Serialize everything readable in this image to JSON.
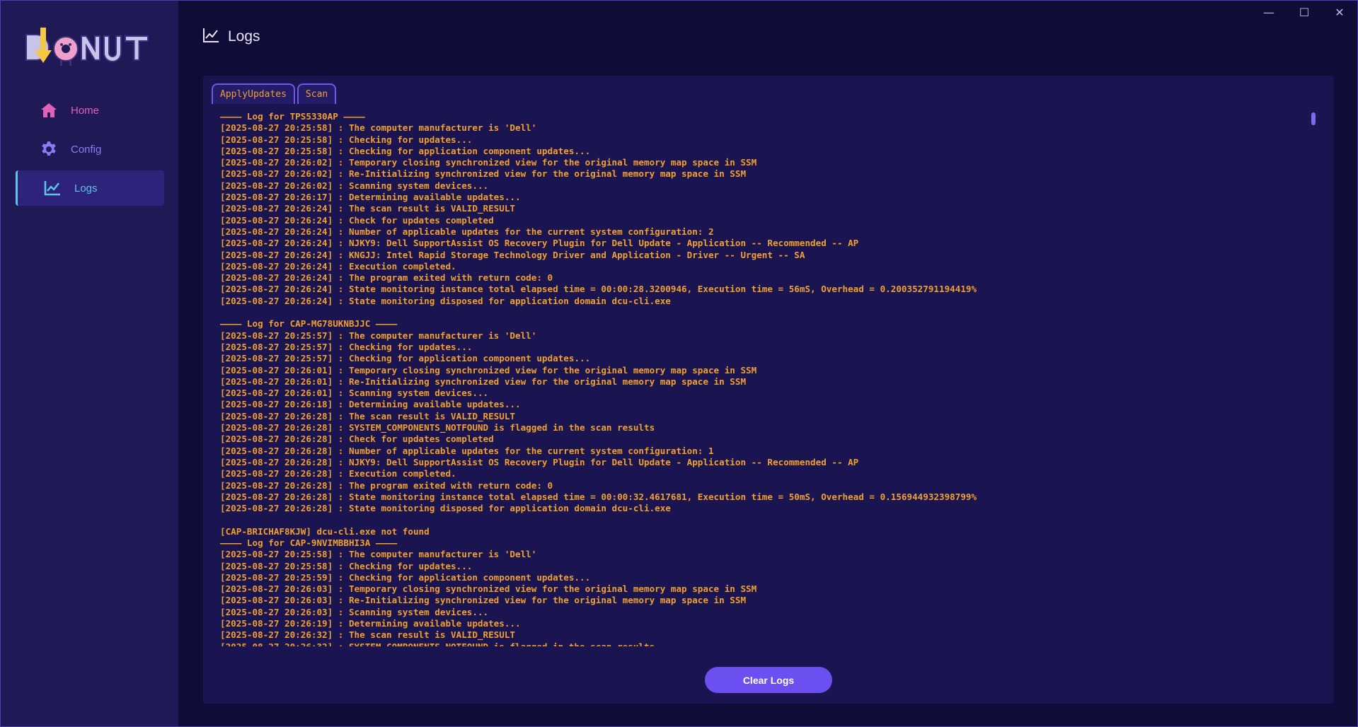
{
  "app": {
    "logo_text": "DONUT"
  },
  "sidebar": {
    "items": [
      {
        "label": "Home",
        "icon": "home-icon",
        "color": "#e45fb8"
      },
      {
        "label": "Config",
        "icon": "gear-icon",
        "color": "#8b7cf5"
      },
      {
        "label": "Logs",
        "icon": "chart-line-icon",
        "color": "#5cc5e8"
      }
    ]
  },
  "header": {
    "title": "Logs"
  },
  "window_controls": {
    "minimize": "—",
    "maximize": "☐",
    "close": "✕"
  },
  "tabs": [
    {
      "label": "ApplyUpdates"
    },
    {
      "label": "Scan"
    }
  ],
  "log_lines": [
    "———— Log for TPS5330AP ————",
    "[2025-08-27 20:25:58] : The computer manufacturer is 'Dell'",
    "[2025-08-27 20:25:58] : Checking for updates...",
    "[2025-08-27 20:25:58] : Checking for application component updates...",
    "[2025-08-27 20:26:02] : Temporary closing synchronized view for the original memory map space in SSM",
    "[2025-08-27 20:26:02] : Re-Initializing synchronized view for the original memory map space in SSM",
    "[2025-08-27 20:26:02] : Scanning system devices...",
    "[2025-08-27 20:26:17] : Determining available updates...",
    "[2025-08-27 20:26:24] : The scan result is VALID_RESULT",
    "[2025-08-27 20:26:24] : Check for updates completed",
    "[2025-08-27 20:26:24] : Number of applicable updates for the current system configuration: 2",
    "[2025-08-27 20:26:24] : NJKY9: Dell SupportAssist OS Recovery Plugin for Dell Update - Application -- Recommended -- AP",
    "[2025-08-27 20:26:24] : KNGJJ: Intel Rapid Storage Technology Driver and Application - Driver -- Urgent -- SA",
    "[2025-08-27 20:26:24] : Execution completed.",
    "[2025-08-27 20:26:24] : The program exited with return code: 0",
    "[2025-08-27 20:26:24] : State monitoring instance total elapsed time = 00:00:28.3200946, Execution time = 56mS, Overhead = 0.200352791194419%",
    "[2025-08-27 20:26:24] : State monitoring disposed for application domain dcu-cli.exe",
    "",
    "———— Log for CAP-MG78UKNBJJC ————",
    "[2025-08-27 20:25:57] : The computer manufacturer is 'Dell'",
    "[2025-08-27 20:25:57] : Checking for updates...",
    "[2025-08-27 20:25:57] : Checking for application component updates...",
    "[2025-08-27 20:26:01] : Temporary closing synchronized view for the original memory map space in SSM",
    "[2025-08-27 20:26:01] : Re-Initializing synchronized view for the original memory map space in SSM",
    "[2025-08-27 20:26:01] : Scanning system devices...",
    "[2025-08-27 20:26:18] : Determining available updates...",
    "[2025-08-27 20:26:28] : The scan result is VALID_RESULT",
    "[2025-08-27 20:26:28] : SYSTEM_COMPONENTS_NOTFOUND is flagged in the scan results",
    "[2025-08-27 20:26:28] : Check for updates completed",
    "[2025-08-27 20:26:28] : Number of applicable updates for the current system configuration: 1",
    "[2025-08-27 20:26:28] : NJKY9: Dell SupportAssist OS Recovery Plugin for Dell Update - Application -- Recommended -- AP",
    "[2025-08-27 20:26:28] : Execution completed.",
    "[2025-08-27 20:26:28] : The program exited with return code: 0",
    "[2025-08-27 20:26:28] : State monitoring instance total elapsed time = 00:00:32.4617681, Execution time = 50mS, Overhead = 0.156944932398799%",
    "[2025-08-27 20:26:28] : State monitoring disposed for application domain dcu-cli.exe",
    "",
    "[CAP-BRICHAF8KJW] dcu-cli.exe not found",
    "———— Log for CAP-9NVIMBBHI3A ————",
    "[2025-08-27 20:25:58] : The computer manufacturer is 'Dell'",
    "[2025-08-27 20:25:58] : Checking for updates...",
    "[2025-08-27 20:25:59] : Checking for application component updates...",
    "[2025-08-27 20:26:03] : Temporary closing synchronized view for the original memory map space in SSM",
    "[2025-08-27 20:26:03] : Re-Initializing synchronized view for the original memory map space in SSM",
    "[2025-08-27 20:26:03] : Scanning system devices...",
    "[2025-08-27 20:26:19] : Determining available updates...",
    "[2025-08-27 20:26:32] : The scan result is VALID_RESULT",
    "[2025-08-27 20:26:32] : SYSTEM_COMPONENTS_NOTFOUND is flagged in the scan results"
  ],
  "actions": {
    "clear_label": "Clear Logs"
  },
  "colors": {
    "log_text": "#f0a030",
    "accent": "#6c4ff0",
    "sidebar_bg": "#1f1a55",
    "panel_bg": "#1a1550"
  }
}
